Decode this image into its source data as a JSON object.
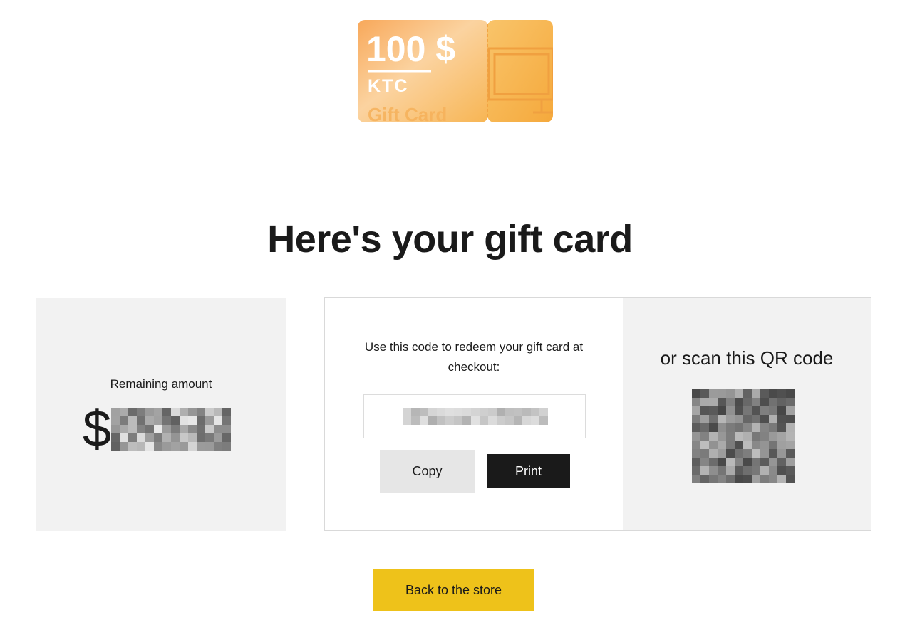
{
  "gift_card_image": {
    "amount_text": "100 $",
    "brand_text": "KTC",
    "caption_text": "Gift Card"
  },
  "page": {
    "title": "Here's your gift card"
  },
  "balance": {
    "label": "Remaining amount",
    "currency_symbol": "$",
    "amount_redacted": true
  },
  "redeem": {
    "instruction": "Use this code to redeem your gift card at checkout:",
    "code_redacted": true,
    "copy_label": "Copy",
    "print_label": "Print"
  },
  "qr": {
    "title": "or scan this QR code",
    "redacted": true
  },
  "footer": {
    "back_label": "Back to the store"
  },
  "colors": {
    "accent_yellow": "#eec21a",
    "dark_button": "#1a1a1a",
    "panel_gray": "#f2f2f2",
    "card_orange": "#f6b04a"
  }
}
